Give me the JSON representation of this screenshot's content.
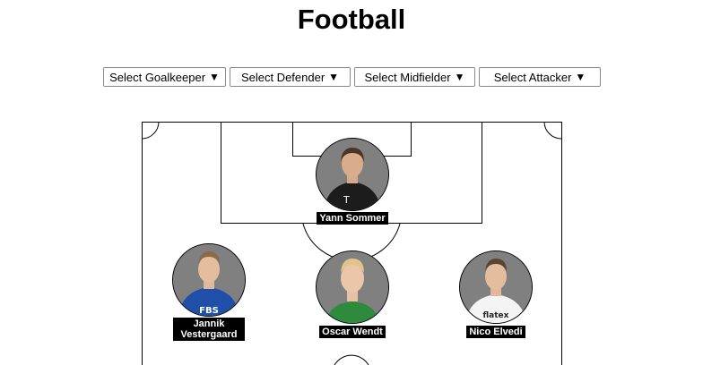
{
  "page": {
    "title": "Football"
  },
  "selects": {
    "goalkeeper": "Select Goalkeeper",
    "defender": "Select Defender",
    "midfielder": "Select Midfielder",
    "attacker": "Select Attacker",
    "caret": "▼"
  },
  "players": {
    "goalkeeper": {
      "name": "Yann Sommer",
      "kit": "#1c1c1c",
      "hair": "#4a3526"
    },
    "defender_left": {
      "name": "Jannik Vestergaard",
      "kit": "#1f4fa8",
      "hair": "#8a6a4a",
      "sponsor": "FBS"
    },
    "defender_center": {
      "name": "Oscar Wendt",
      "kit": "#2e8b3e",
      "hair": "#e2c48a"
    },
    "defender_right": {
      "name": "Nico Elvedi",
      "kit": "#f4f4f4",
      "hair": "#5a4330",
      "sponsor": "flatex"
    }
  }
}
